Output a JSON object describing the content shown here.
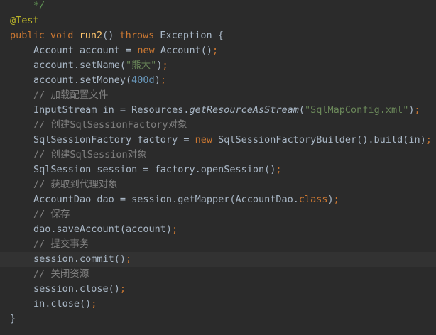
{
  "editor": {
    "lines": {
      "l0": {
        "doc_end": "*/"
      },
      "l1": {
        "annotation": "@Test"
      },
      "l2": {
        "kw_public": "public",
        "kw_void": "void",
        "method": "run2",
        "parens": "()",
        "kw_throws": "throws",
        "exc": "Exception",
        "brace": "{"
      },
      "l3": {
        "pre": "Account account = ",
        "kw_new": "new",
        "post": "Account()",
        "semi": ";"
      },
      "l4": {
        "pre": "account.setName(",
        "str": "\"熊大\"",
        "post": ")",
        "semi": ";"
      },
      "l5": {
        "pre": "account.setMoney(",
        "num": "400d",
        "post": ")",
        "semi": ";"
      },
      "l6": {
        "comment": "// 加载配置文件"
      },
      "l7": {
        "pre": "InputStream in = Resources.",
        "call": "getResourceAsStream",
        "open": "(",
        "str": "\"SqlMapConfig.xml\"",
        "close": ")",
        "semi": ";"
      },
      "l8": {
        "comment": "// 创建SqlSessionFactory对象"
      },
      "l9": {
        "pre": "SqlSessionFactory factory = ",
        "kw_new": "new",
        "post": "SqlSessionFactoryBuilder().build(in)",
        "semi": ";"
      },
      "l10": {
        "comment": "// 创建SqlSession对象"
      },
      "l11": {
        "pre": "SqlSession session = factory.openSession()",
        "semi": ";"
      },
      "l12": {
        "comment": "// 获取到代理对象"
      },
      "l13": {
        "pre": "AccountDao dao = session.getMapper(AccountDao.",
        "kw_class": "class",
        "post": ")",
        "semi": ";"
      },
      "l14": {
        "comment": "// 保存"
      },
      "l15": {
        "pre": "dao.saveAccount(account)",
        "semi": ";"
      },
      "l16": {
        "comment": "// 提交事务"
      },
      "l17": {
        "pre": "session.commit()",
        "semi": ";"
      },
      "l18": {
        "comment": "// 关闭资源"
      },
      "l19": {
        "pre": "session.close()",
        "semi": ";"
      },
      "l20": {
        "pre": "in.close()",
        "semi": ";"
      },
      "l21": {
        "brace": "}"
      }
    }
  },
  "colors": {
    "background": "#2b2b2b",
    "current_line": "#323232",
    "text": "#a9b7c6",
    "keyword": "#cc7832",
    "string": "#6a8759",
    "number": "#6897bb",
    "comment": "#808080",
    "annotation": "#bbb529",
    "method_decl": "#ffc66d"
  }
}
